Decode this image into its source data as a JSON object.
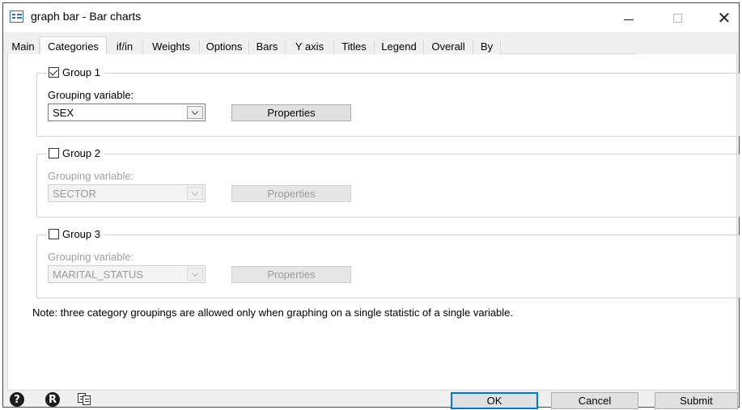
{
  "window": {
    "title": "graph bar - Bar charts",
    "minimize_glyph": "—",
    "close_glyph": "✕"
  },
  "tabs": [
    {
      "label": "Main",
      "active": false
    },
    {
      "label": "Categories",
      "active": true
    },
    {
      "label": "if/in",
      "active": false
    },
    {
      "label": "Weights",
      "active": false
    },
    {
      "label": "Options",
      "active": false
    },
    {
      "label": "Bars",
      "active": false
    },
    {
      "label": "Y axis",
      "active": false
    },
    {
      "label": "Titles",
      "active": false
    },
    {
      "label": "Legend",
      "active": false
    },
    {
      "label": "Overall",
      "active": false
    },
    {
      "label": "By",
      "active": false
    }
  ],
  "groups": [
    {
      "label": "Group 1",
      "checked": true,
      "enabled": true,
      "var_label": "Grouping variable:",
      "variable": "SEX",
      "properties_label": "Properties"
    },
    {
      "label": "Group 2",
      "checked": false,
      "enabled": false,
      "var_label": "Grouping variable:",
      "variable": "SECTOR",
      "properties_label": "Properties"
    },
    {
      "label": "Group 3",
      "checked": false,
      "enabled": false,
      "var_label": "Grouping variable:",
      "variable": "MARITAL_STATUS",
      "properties_label": "Properties"
    }
  ],
  "note": "Note: three category groupings are allowed only when graphing on a single statistic of a single variable.",
  "footer": {
    "help_glyph": "?",
    "reset_glyph": "R",
    "ok_label": "OK",
    "cancel_label": "Cancel",
    "submit_label": "Submit"
  },
  "colors": {
    "accent": "#0078d7",
    "disabled_text": "#a0a0a0"
  }
}
